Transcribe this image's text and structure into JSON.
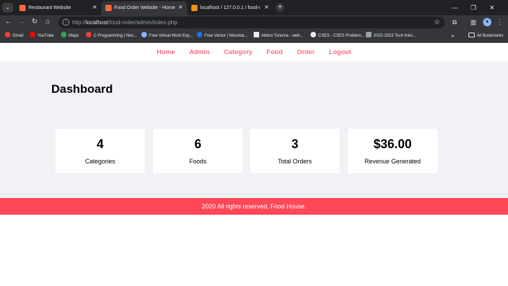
{
  "browser": {
    "tabs": [
      {
        "title": "Restaurant Website",
        "favicon_color": "#ff6b35",
        "active": false
      },
      {
        "title": "Food Order Website - Home Page",
        "favicon_color": "#ff6b35",
        "active": true
      },
      {
        "title": "localhost / 127.0.0.1 / food-order",
        "favicon_color": "#f29111",
        "active": false
      }
    ],
    "tab_close": "✕",
    "new_tab": "+",
    "window_controls": {
      "minimize": "—",
      "restore": "❐",
      "close": "✕"
    },
    "url_prefix": "http://",
    "url_host": "localhost",
    "url_path": "/food-order/admin/index.php",
    "bookmarks": [
      {
        "label": "Gmail",
        "icon": "gmail-icon",
        "color": "#ea4335"
      },
      {
        "label": "YouTube",
        "icon": "youtube-icon",
        "color": "#ff0000"
      },
      {
        "label": "Maps",
        "icon": "maps-icon",
        "color": "#34a853"
      },
      {
        "label": "C Programming | Nes...",
        "icon": "c-programming-icon",
        "color": "#ea4335"
      },
      {
        "label": "Free Virtual Work Exp...",
        "icon": "diamond-icon",
        "color": "#8ab4f8"
      },
      {
        "label": "Free Vector | Mountai...",
        "icon": "freepik-icon",
        "color": "#1a73e8"
      },
      {
        "label": "Albino Tonnina - web...",
        "icon": "albino-icon",
        "color": "#e8eaed"
      },
      {
        "label": "CSES - CSES Problem...",
        "icon": "globe-icon",
        "color": "#e8eaed"
      },
      {
        "label": "2022-2023 Tech Inter...",
        "icon": "chart-icon",
        "color": "#9aa0a6"
      }
    ],
    "more_bookmarks": "»",
    "all_bookmarks": "All Bookmarks"
  },
  "site": {
    "menu": [
      "Home",
      "Admin",
      "Category",
      "Food",
      "Order",
      "Logout"
    ],
    "heading": "Dashboard",
    "cards": [
      {
        "value": "4",
        "label": "Categories"
      },
      {
        "value": "6",
        "label": "Foods"
      },
      {
        "value": "3",
        "label": "Total Orders"
      },
      {
        "value": "$36.00",
        "label": "Revenue Generated"
      }
    ],
    "footer_text": "2020 All rights reserved, Food House."
  },
  "colors": {
    "menu_link": "#ff6b81",
    "footer_bg": "#ff4757",
    "content_bg": "#f1f2f6"
  }
}
